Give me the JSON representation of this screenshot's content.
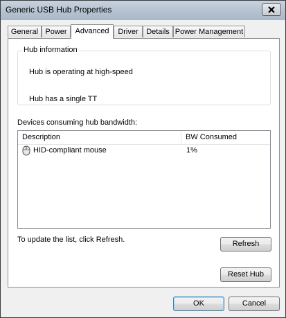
{
  "window": {
    "title": "Generic USB Hub Properties"
  },
  "tabs": [
    {
      "label": "General"
    },
    {
      "label": "Power"
    },
    {
      "label": "Advanced"
    },
    {
      "label": "Driver"
    },
    {
      "label": "Details"
    },
    {
      "label": "Power Management"
    }
  ],
  "active_tab": "Advanced",
  "hub_info": {
    "group_label": "Hub information",
    "line1": "Hub is operating at high-speed",
    "line2": "Hub has a single TT"
  },
  "devices": {
    "label": "Devices consuming hub bandwidth:",
    "columns": [
      "Description",
      "BW Consumed"
    ],
    "rows": [
      {
        "description": "HID-compliant mouse",
        "bw": "1%",
        "icon": "mouse-icon"
      }
    ]
  },
  "update_text": "To update the list, click Refresh.",
  "buttons": {
    "refresh": "Refresh",
    "reset_hub": "Reset Hub",
    "ok": "OK",
    "cancel": "Cancel"
  },
  "colors": {
    "accent_default_button": "#3c7fb1"
  }
}
